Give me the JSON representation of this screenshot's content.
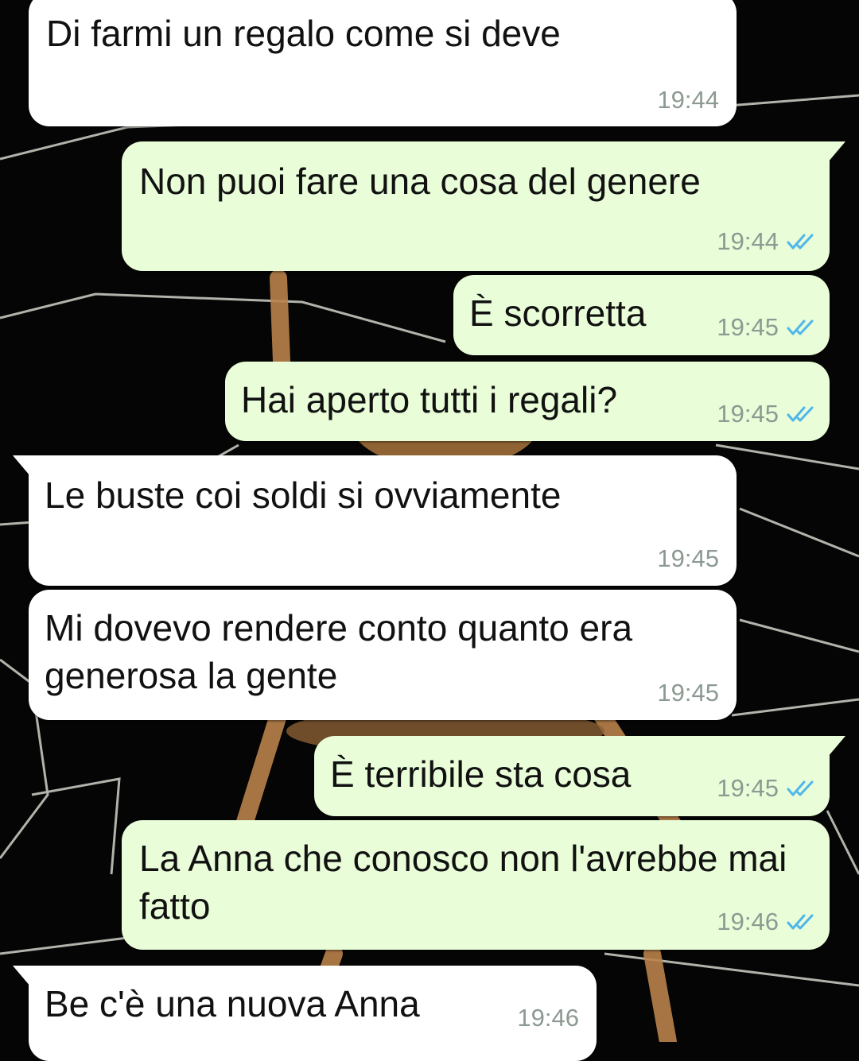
{
  "chat": {
    "messages": [
      {
        "direction": "in",
        "text": "Di farmi un regalo come si deve",
        "time": "19:44"
      },
      {
        "direction": "out",
        "text": "Non puoi fare una cosa del genere",
        "time": "19:44",
        "status": "read",
        "status_icon": "double-check-icon"
      },
      {
        "direction": "out",
        "text": "È scorretta",
        "time": "19:45",
        "status": "read",
        "status_icon": "double-check-icon"
      },
      {
        "direction": "out",
        "text": "Hai aperto tutti i regali?",
        "time": "19:45",
        "status": "read",
        "status_icon": "double-check-icon"
      },
      {
        "direction": "in",
        "text": "Le buste coi soldi si ovviamente",
        "time": "19:45"
      },
      {
        "direction": "in",
        "text": "Mi dovevo rendere conto quanto era generosa la gente",
        "time": "19:45"
      },
      {
        "direction": "out",
        "text": "È terribile sta cosa",
        "time": "19:45",
        "status": "read",
        "status_icon": "double-check-icon"
      },
      {
        "direction": "out",
        "text": "La Anna che conosco non l'avrebbe mai fatto",
        "time": "19:46",
        "status": "read",
        "status_icon": "double-check-icon"
      },
      {
        "direction": "in",
        "text": "Be c'è una nuova Anna",
        "time": "19:46"
      }
    ]
  },
  "colors": {
    "incoming_bubble": "#ffffff",
    "outgoing_bubble": "#e8fdd8",
    "timestamp": "#8c9a92",
    "read_ticks": "#4fb6ec",
    "wallpaper": "#050505"
  },
  "wallpaper_subject": "spider on web"
}
